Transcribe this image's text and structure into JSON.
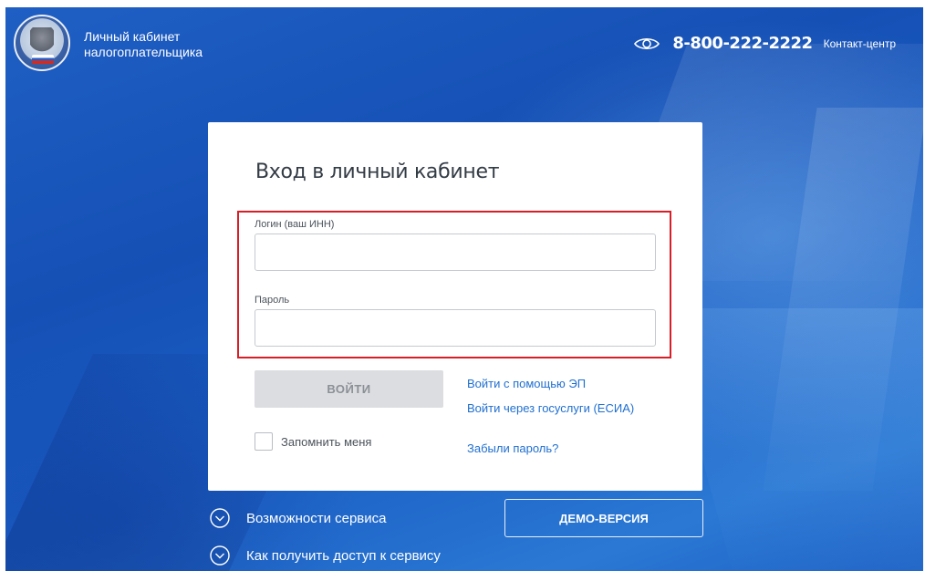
{
  "header": {
    "brand_line1": "Личный кабинет",
    "brand_line2": "налогоплательщика",
    "phone": "8-800-222-2222",
    "contact_label": "Контакт-центр",
    "accessibility_icon": "eye-icon",
    "logo_icon": "fns-emblem-icon"
  },
  "login": {
    "title": "Вход в личный кабинет",
    "login_label": "Логин (ваш ИНН)",
    "login_value": "",
    "password_label": "Пароль",
    "password_value": "",
    "submit_label": "ВОЙТИ",
    "remember_label": "Запомнить меня",
    "remember_checked": false,
    "link_ep": "Войти с помощью ЭП",
    "link_esia": "Войти через госуслуги (ЕСИА)",
    "link_forgot": "Забыли пароль?"
  },
  "footer": {
    "features_label": "Возможности сервиса",
    "access_label": "Как получить доступ к сервису",
    "demo_label": "ДЕМО-ВЕРСИЯ",
    "expand_icon": "chevron-down-circle-icon"
  },
  "colors": {
    "background": "#1a58c0",
    "highlight_border": "#d81e27",
    "link": "#1f6fd1",
    "button_disabled": "#dcdde0"
  }
}
